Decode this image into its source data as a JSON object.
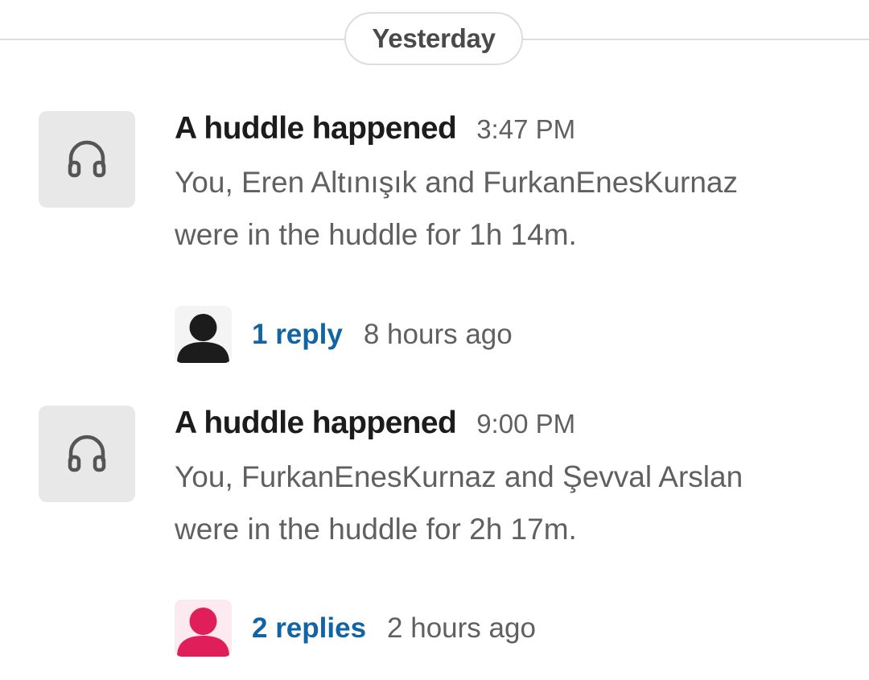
{
  "divider": {
    "date_label": "Yesterday"
  },
  "messages": [
    {
      "title": "A huddle happened",
      "time": "3:47 PM",
      "body_line1": "You, Eren Altınışık and FurkanEnesKurnaz",
      "body_line2": "were in the huddle for 1h 14m.",
      "icon": "headphones-icon",
      "thread": {
        "reply_label": "1 reply",
        "last_reply": "8 hours ago",
        "avatar_color": "#1d1c1d"
      }
    },
    {
      "title": "A huddle happened",
      "time": "9:00 PM",
      "body_line1": "You, FurkanEnesKurnaz and Şevval Arslan",
      "body_line2": "were in the huddle for 2h 17m.",
      "icon": "headphones-icon",
      "thread": {
        "reply_label": "2 replies",
        "last_reply": "2 hours ago",
        "avatar_color": "#e01e5a"
      }
    }
  ],
  "colors": {
    "link": "#1264a3",
    "muted_text": "#616061",
    "title_text": "#1d1c1d",
    "tile_background": "#e8e8e8"
  }
}
